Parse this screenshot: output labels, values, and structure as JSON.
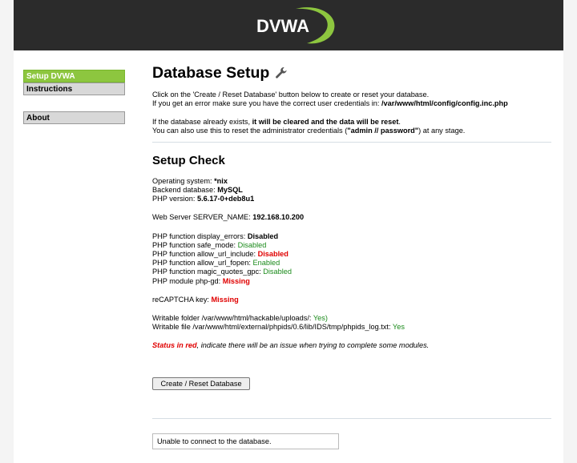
{
  "brand": {
    "logo_text": "DVWA",
    "accent": "#8dc63f",
    "header_bg": "#2b2b2b"
  },
  "menu": {
    "items": [
      {
        "label": "Setup DVWA",
        "active": true
      },
      {
        "label": "Instructions",
        "active": false
      },
      {
        "label": "About",
        "active": false
      }
    ]
  },
  "main": {
    "title": "Database Setup",
    "title_icon": "wrench-icon",
    "intro_1a": "Click on the 'Create / Reset Database' button below to create or reset your database.",
    "intro_2a": "If you get an error make sure you have the correct user credentials in: ",
    "intro_2b": "/var/www/html/config/config.inc.php",
    "intro_3a": "If the database already exists, ",
    "intro_3b": "it will be cleared and the data will be reset",
    "intro_3c": ".",
    "intro_4a": "You can also use this to reset the administrator credentials (",
    "intro_4b": "\"admin // password\"",
    "intro_4c": ") at any stage.",
    "setup_title": "Setup Check",
    "os_label": "Operating system: ",
    "os_value": "*nix",
    "db_label": "Backend database: ",
    "db_value": "MySQL",
    "php_label": "PHP version: ",
    "php_value": "5.6.17-0+deb8u1",
    "server_label": "Web Server SERVER_NAME: ",
    "server_value": "192.168.10.200",
    "f1_label": "PHP function display_errors: ",
    "f1_value": "Disabled",
    "f2_label": "PHP function safe_mode: ",
    "f2_value": "Disabled",
    "f3_label": "PHP function allow_url_include: ",
    "f3_value": "Disabled",
    "f4_label": "PHP function allow_url_fopen: ",
    "f4_value": "Enabled",
    "f5_label": "PHP function magic_quotes_gpc: ",
    "f5_value": "Disabled",
    "f6_label": "PHP module php-gd: ",
    "f6_value": "Missing",
    "recaptcha_label": "reCAPTCHA key: ",
    "recaptcha_value": "Missing",
    "w1_label": "Writable folder /var/www/html/hackable/uploads/: ",
    "w1_value": "Yes)",
    "w2_label": "Writable file /var/www/html/external/phpids/0.6/lib/IDS/tmp/phpids_log.txt: ",
    "w2_value": "Yes",
    "status_red": "Status in red",
    "status_rest": ", indicate there will be an issue when trying to complete some modules.",
    "reset_button": "Create / Reset Database",
    "message": "Unable to connect to the database."
  }
}
